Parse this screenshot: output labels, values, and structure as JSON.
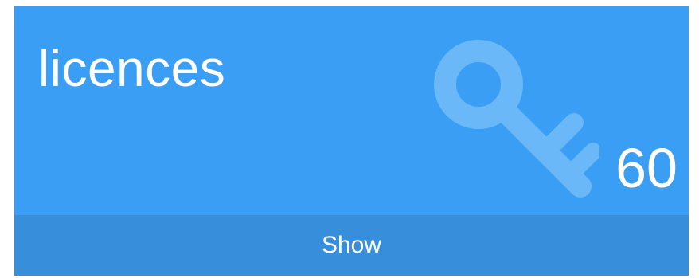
{
  "widget": {
    "title": "licences",
    "count": "60",
    "icon": "key-icon",
    "footer_label": "Show",
    "colors": {
      "body_background": "#3a9ef4",
      "footer_background": "#378fdb",
      "text": "#ffffff",
      "icon_tint": "#6bb8f8"
    }
  }
}
